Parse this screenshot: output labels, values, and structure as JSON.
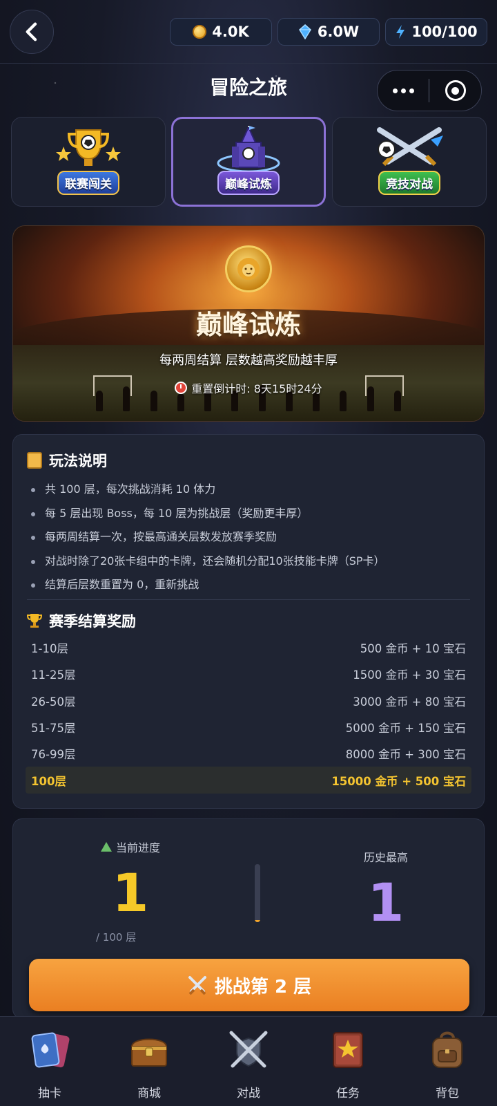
{
  "topbar": {
    "resources": {
      "coins": "4.0K",
      "gems": "6.0W",
      "energy": "100/100"
    }
  },
  "header": {
    "title": "冒险之旅"
  },
  "mode_tabs": [
    {
      "label": "联赛闯关",
      "active": false
    },
    {
      "label": "巅峰试炼",
      "active": true
    },
    {
      "label": "竞技对战",
      "active": false
    }
  ],
  "banner": {
    "title": "巅峰试炼",
    "subtitle": "每两周结算 层数越高奖励越丰厚",
    "timer": "重置倒计时: 8天15时24分"
  },
  "rules": {
    "heading": "玩法说明",
    "items": [
      "共 100 层，每次挑战消耗 10 体力",
      "每 5 层出现 Boss，每 10 层为挑战层（奖励更丰厚）",
      "每两周结算一次，按最高通关层数发放赛季奖励",
      "对战时除了20张卡组中的卡牌，还会随机分配10张技能卡牌（SP卡）",
      "结算后层数重置为 0，重新挑战"
    ]
  },
  "rewards": {
    "heading": "赛季结算奖励",
    "rows": [
      {
        "range": "1-10层",
        "reward": "500 金币 + 10 宝石"
      },
      {
        "range": "11-25层",
        "reward": "1500 金币 + 30 宝石"
      },
      {
        "range": "26-50层",
        "reward": "3000 金币 + 80 宝石"
      },
      {
        "range": "51-75层",
        "reward": "5000 金币 + 150 宝石"
      },
      {
        "range": "76-99层",
        "reward": "8000 金币 + 300 宝石"
      },
      {
        "range": "100层",
        "reward": "15000 金币 + 500 宝石",
        "highlight": true
      }
    ]
  },
  "progress": {
    "current_label": "当前进度",
    "current_value": "1",
    "total_label": "/ 100 层",
    "fill_fraction": 0.01,
    "best_label": "历史最高",
    "best_value": "1",
    "challenge_button": "挑战第 2 层"
  },
  "bottom_nav": [
    {
      "label": "抽卡",
      "icon": "cards-icon"
    },
    {
      "label": "商城",
      "icon": "treasure-chest-icon"
    },
    {
      "label": "对战",
      "icon": "crossed-swords-shield-icon"
    },
    {
      "label": "任务",
      "icon": "quest-book-icon"
    },
    {
      "label": "背包",
      "icon": "backpack-icon"
    }
  ],
  "colors": {
    "accent_orange": "#ea7f22",
    "highlight_gold": "#f4c430",
    "best_purple": "#b290f3",
    "active_tab_border": "#8c72d6"
  }
}
